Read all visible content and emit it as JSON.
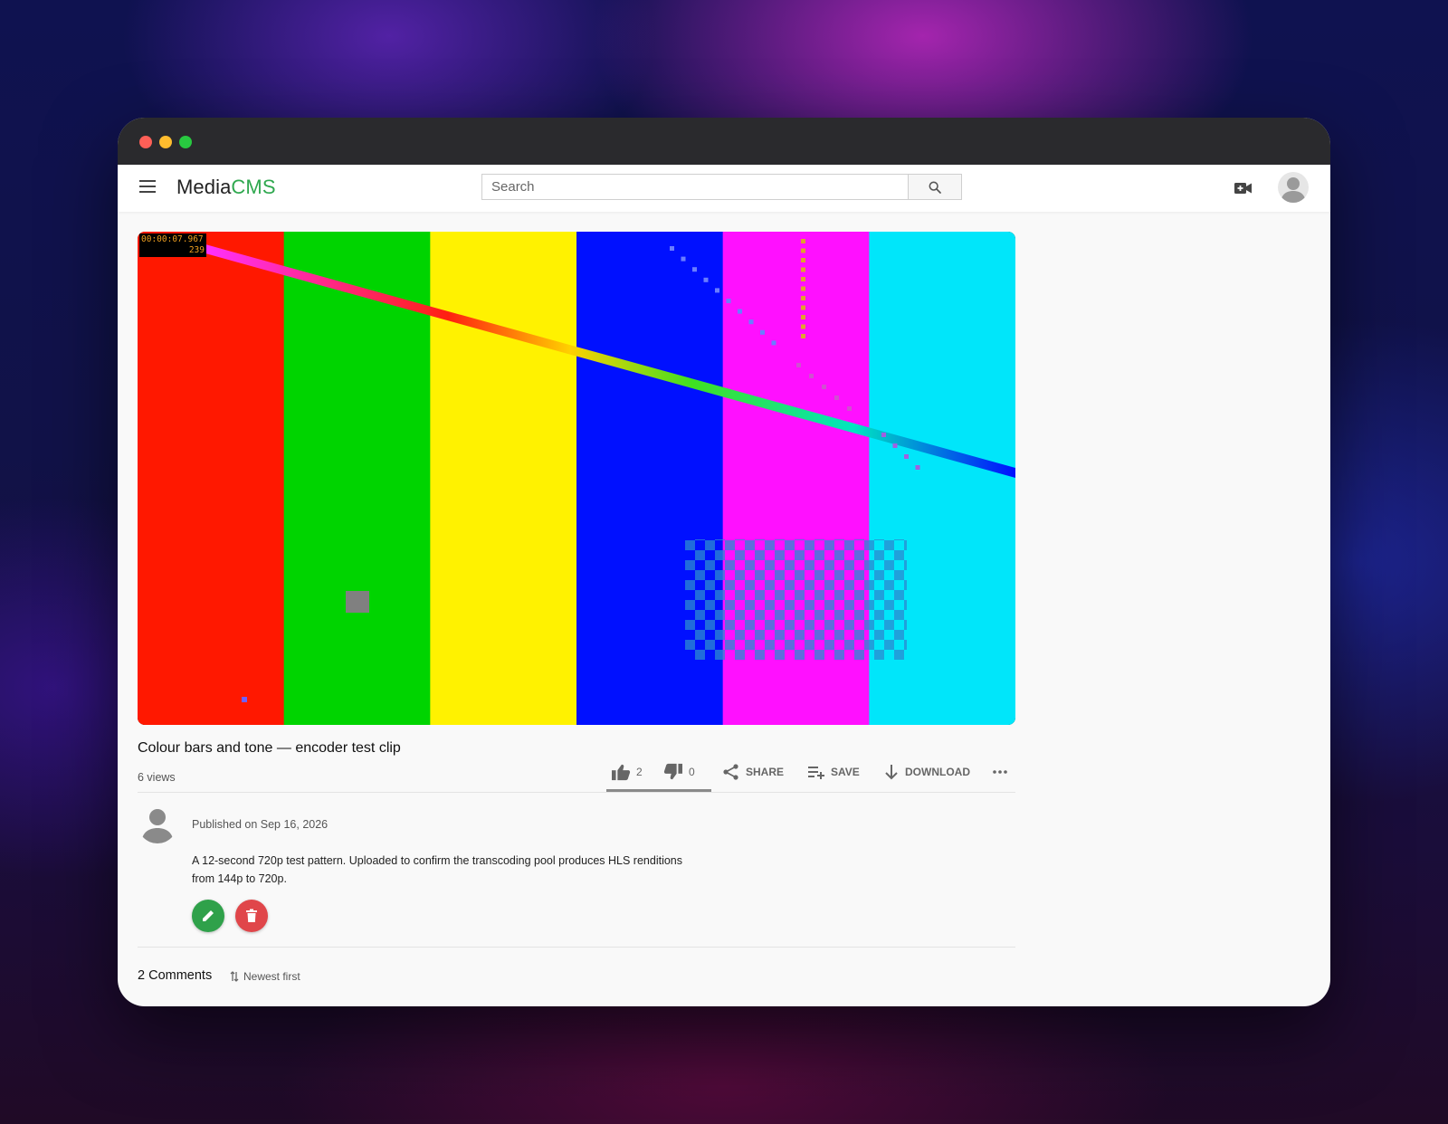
{
  "app": {
    "logo_main": "Media",
    "logo_accent": "CMS",
    "accent_color": "#2fa84f"
  },
  "search": {
    "placeholder": "Search"
  },
  "icons": {
    "menu": "hamburger-menu-icon",
    "search": "search-icon",
    "upload": "video-upload-icon",
    "user": "user-avatar-icon",
    "like": "thumbs-up-icon",
    "dislike": "thumbs-down-icon",
    "share": "share-icon",
    "save": "playlist-add-icon",
    "download": "download-icon",
    "more": "more-horizontal-icon",
    "edit": "pencil-icon",
    "delete": "trash-icon",
    "sort": "sort-arrows-icon"
  },
  "video": {
    "timecode": "00:00:07.967",
    "frame": "239",
    "bar_colors": [
      "#ff1800",
      "#00d400",
      "#fff200",
      "#0010ff",
      "#ff10ff",
      "#00e6fa"
    ]
  },
  "media": {
    "title": "Colour bars and tone — encoder test clip",
    "views": "6 views"
  },
  "actions": {
    "like_count": "2",
    "dislike_count": "0",
    "share_label": "SHARE",
    "save_label": "SAVE",
    "download_label": "DOWNLOAD"
  },
  "details": {
    "published": "Published on Sep 16, 2026",
    "description_line1": "A 12-second 720p test pattern. Uploaded to confirm the transcoding pool produces HLS renditions",
    "description_line2": "from 144p to 720p."
  },
  "comments": {
    "count_label": "2 Comments",
    "sort_label": "Newest first"
  },
  "colors": {
    "edit_button": "#2fa14a",
    "delete_button": "#e0464a"
  }
}
